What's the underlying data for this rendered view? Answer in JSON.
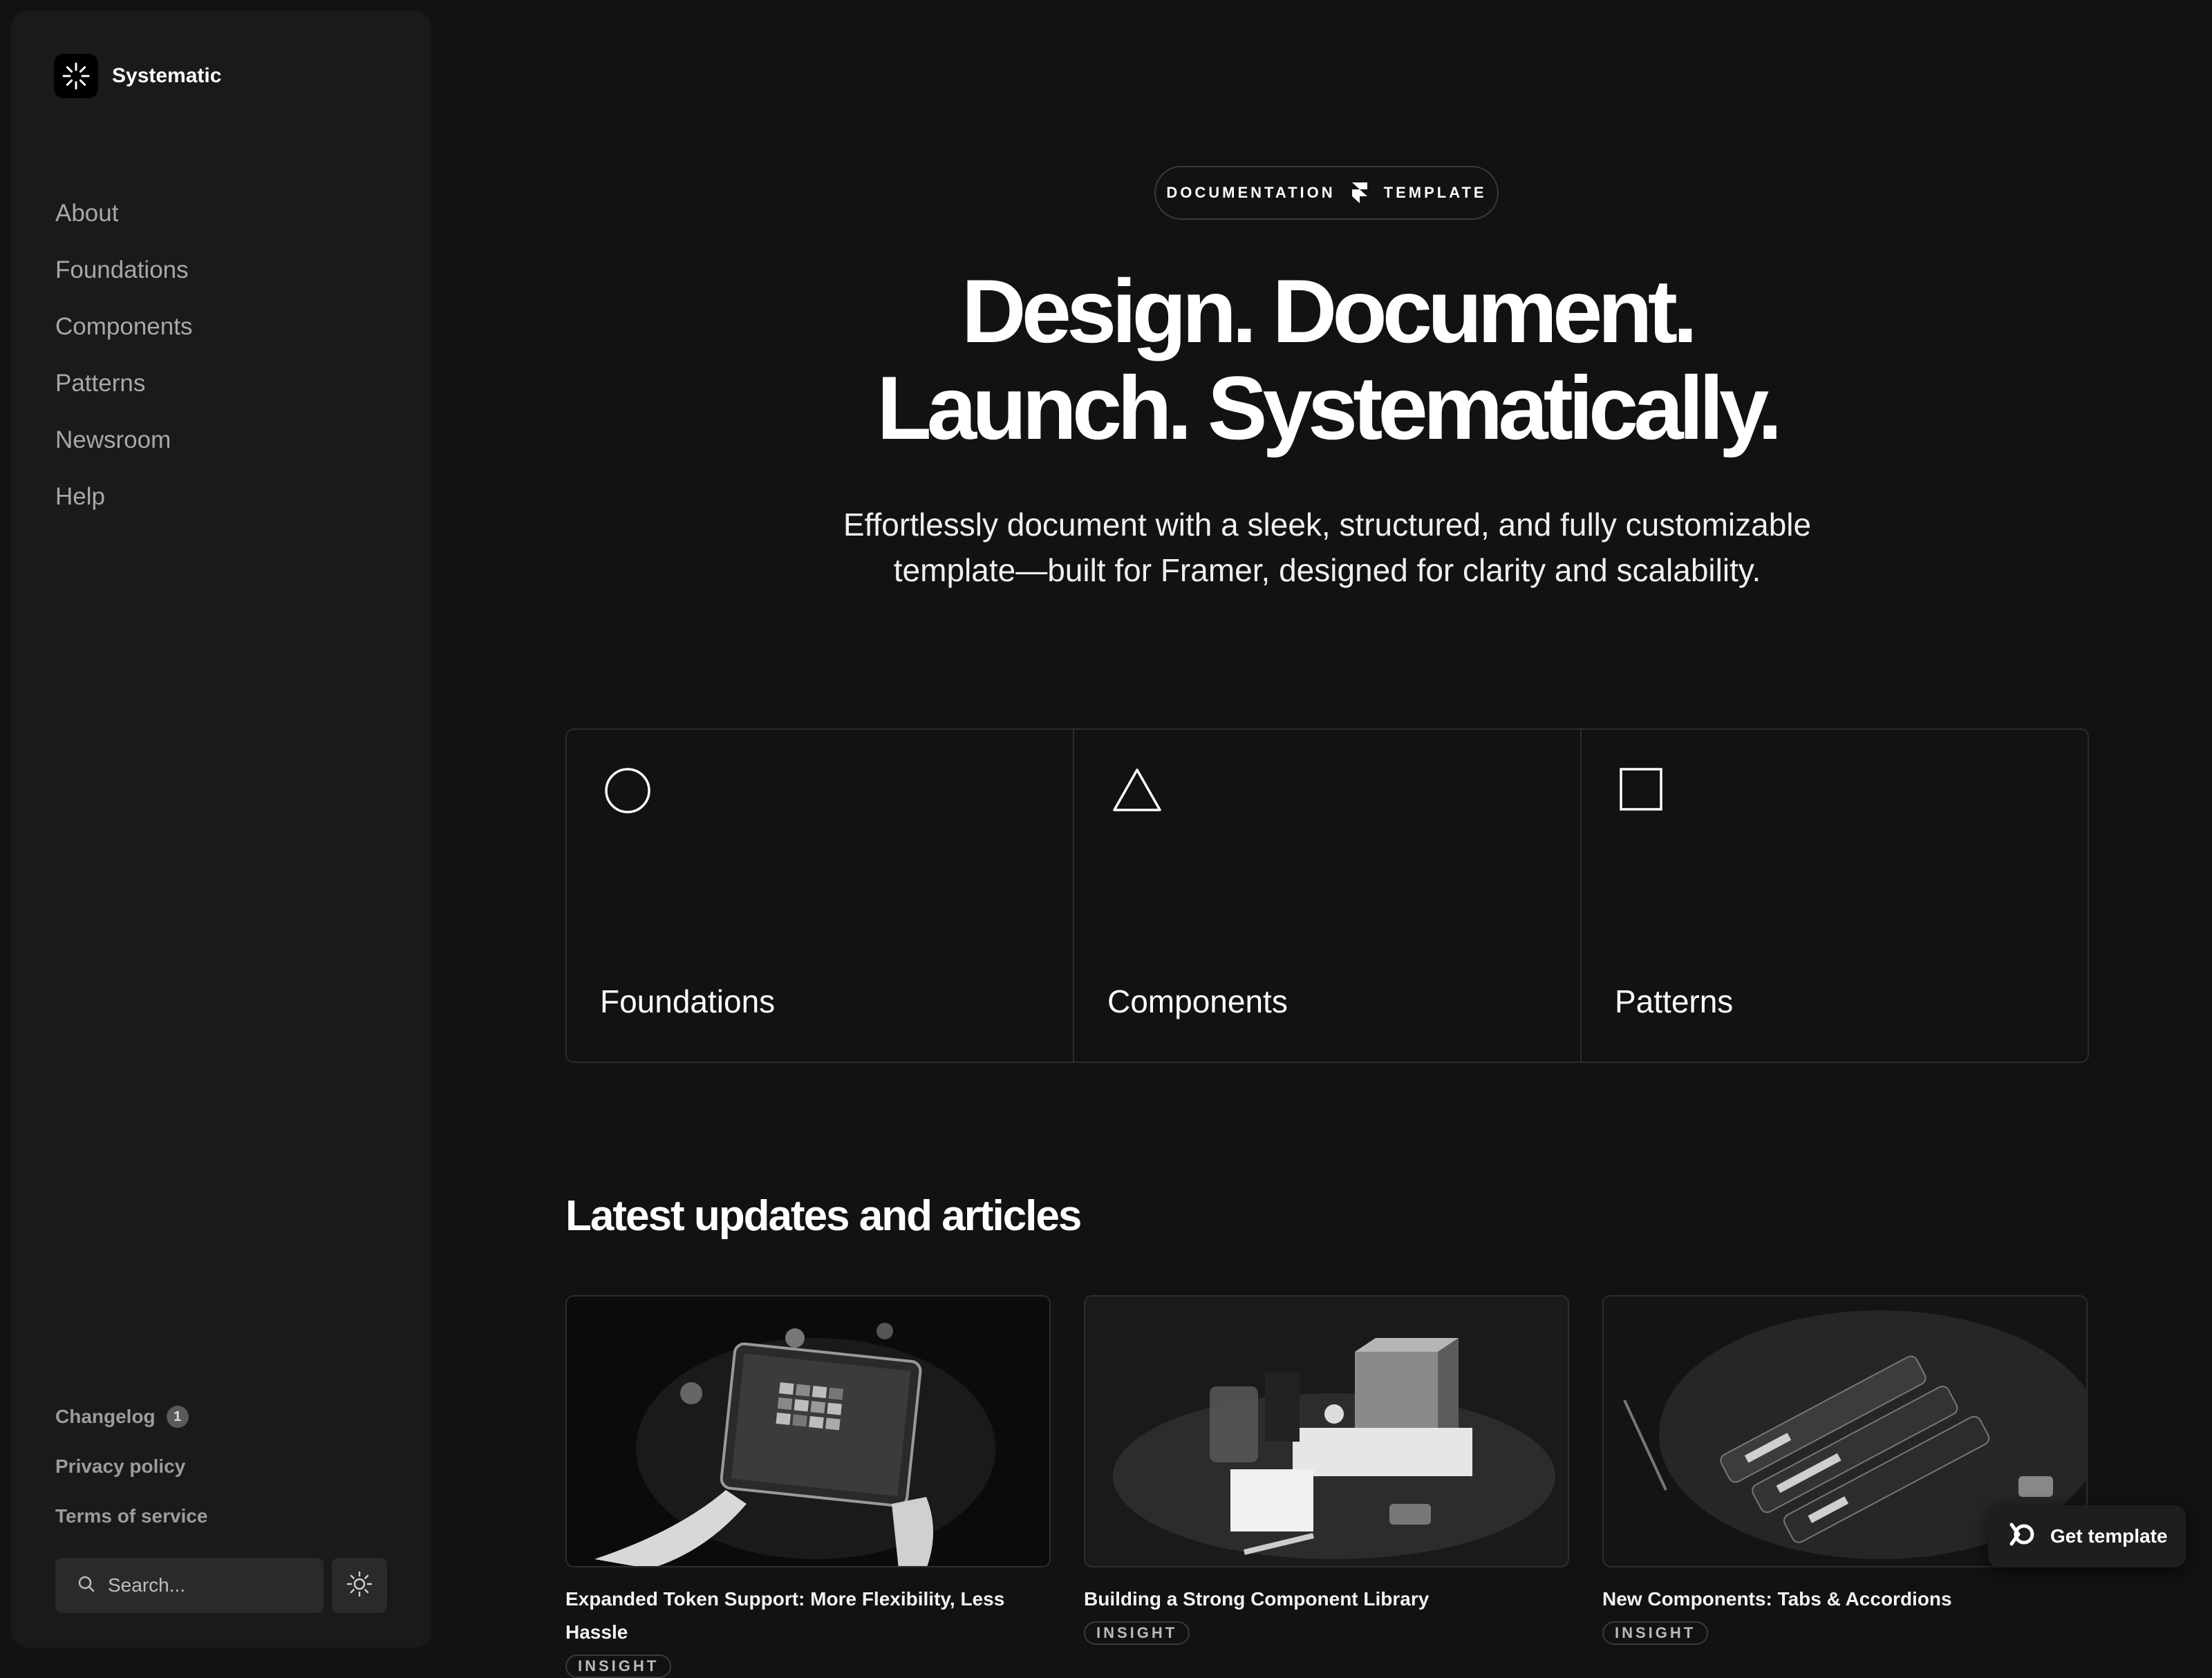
{
  "brand": {
    "name": "Systematic",
    "logo_icon": "burst-logo-icon"
  },
  "sidebar": {
    "nav": [
      {
        "label": "About"
      },
      {
        "label": "Foundations"
      },
      {
        "label": "Components"
      },
      {
        "label": "Patterns"
      },
      {
        "label": "Newsroom"
      },
      {
        "label": "Help"
      }
    ],
    "footer_links": {
      "changelog": "Changelog",
      "changelog_count": "1",
      "privacy": "Privacy policy",
      "terms": "Terms of service"
    },
    "search": {
      "placeholder": "Search...",
      "icon": "search-icon"
    },
    "theme_toggle_icon": "sun-icon"
  },
  "hero": {
    "pill_left": "DOCUMENTATION",
    "pill_right": "TEMPLATE",
    "headline_line1": "Design. Document.",
    "headline_line2": "Launch. Systematically.",
    "subtext_line1": "Effortlessly document with a sleek, structured, and fully customizable",
    "subtext_line2": "template—built for Framer, designed for clarity and scalability."
  },
  "cards": [
    {
      "title": "Foundations",
      "icon": "circle-icon"
    },
    {
      "title": "Components",
      "icon": "triangle-icon"
    },
    {
      "title": "Patterns",
      "icon": "square-icon"
    }
  ],
  "articles_section": {
    "title": "Latest updates and articles",
    "items": [
      {
        "title": "Expanded Token Support: More Flexibility, Less Hassle",
        "tag": "INSIGHT"
      },
      {
        "title": "Building a Strong Component Library",
        "tag": "INSIGHT"
      },
      {
        "title": "New Components: Tabs & Accordions",
        "tag": "INSIGHT"
      }
    ]
  },
  "cta": {
    "label": "Get template",
    "icon": "framer-icon"
  },
  "colors": {
    "background": "#121212",
    "sidebar": "#1a1a1a",
    "text": "#ffffff",
    "muted": "#a8a8a8"
  }
}
